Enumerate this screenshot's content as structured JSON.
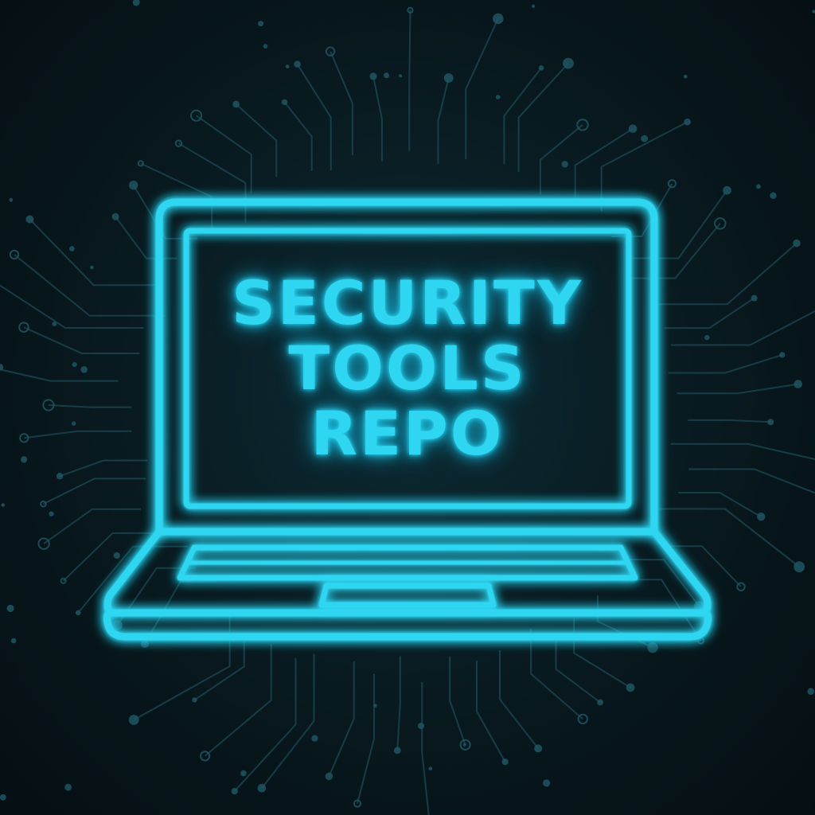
{
  "screen": {
    "lines": [
      "SECURITY",
      "TOOLS",
      "REPO"
    ]
  },
  "colors": {
    "neon": "#2fd6f2",
    "glow": "#16b8dc",
    "background": "#071318",
    "circuit": "#1c4a55"
  },
  "icons": {
    "laptop": "laptop-icon",
    "background": "circuit-board-pattern"
  }
}
